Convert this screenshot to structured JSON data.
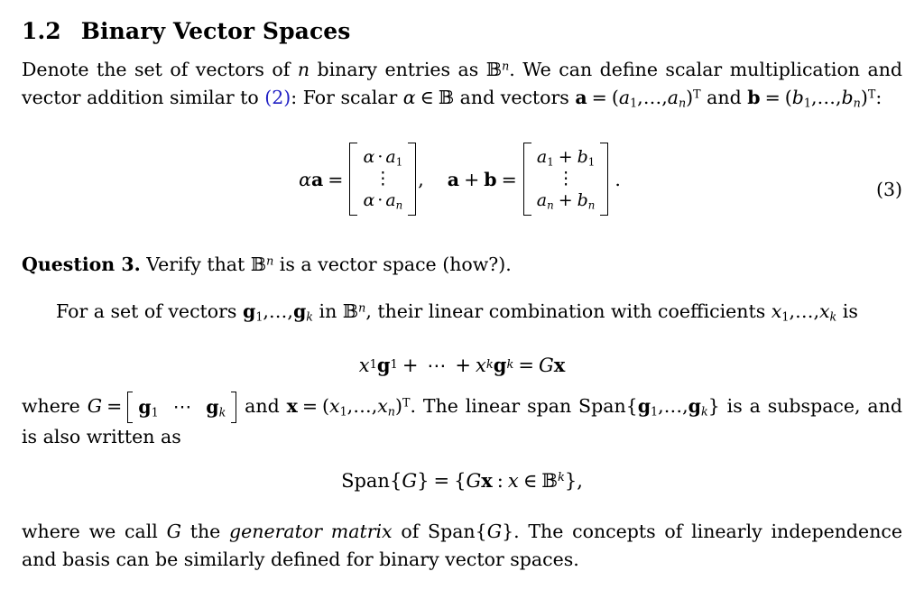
{
  "document": {
    "type": "latex-lecture-notes",
    "background_color": "#ffffff",
    "text_color": "#000000",
    "link_color": "#1f1fc4"
  },
  "section": {
    "number": "1.2",
    "title": "Binary Vector Spaces"
  },
  "paragraph_1": {
    "seg_1": "Denote the set of vectors of ",
    "var_n": "n",
    "seg_2": " binary entries as ",
    "bb_B": "B",
    "sup_n": "n",
    "seg_3": ". We can define scalar multiplication and vector addition similar to ",
    "ref_2": "(2)",
    "seg_4": ": For scalar ",
    "alpha": "α",
    "in": "∈",
    "seg_5": " and vectors ",
    "vec_a": "a",
    "equals": "=",
    "a_tuple_open": "(",
    "a_1": "a",
    "a_1_sub": "1",
    "a_dots": ",…,",
    "a_n": "a",
    "a_n_sub": "n",
    "a_tuple_close": ")",
    "transpose": "T",
    "seg_6": " and ",
    "vec_b": "b",
    "b_1": "b",
    "b_1_sub": "1",
    "b_n": "b",
    "b_n_sub": "n",
    "colon": ":"
  },
  "equation_3": {
    "number": "(3)",
    "lhs": {
      "alpha": "α",
      "vec_a": "a",
      "equals": "="
    },
    "matrix_1": {
      "rows": [
        "α · a₁",
        "⋮",
        "α · aₙ"
      ],
      "row_1_parts": {
        "alpha": "α",
        "dot": "·",
        "var": "a",
        "sub": "1"
      },
      "row_mid": "⋮",
      "row_n_parts": {
        "alpha": "α",
        "dot": "·",
        "var": "a",
        "sub": "n"
      }
    },
    "separator": ",",
    "rhs": {
      "vec_a": "a",
      "plus": "+",
      "vec_b": "b",
      "equals": "="
    },
    "matrix_2": {
      "rows": [
        "a₁ + b₁",
        "⋮",
        "aₙ + bₙ"
      ],
      "row_1_parts": {
        "a": "a",
        "a_sub": "1",
        "plus": "+",
        "b": "b",
        "b_sub": "1"
      },
      "row_mid": "⋮",
      "row_n_parts": {
        "a": "a",
        "a_sub": "n",
        "plus": "+",
        "b": "b",
        "b_sub": "n"
      }
    },
    "period": "."
  },
  "question_3": {
    "label": "Question 3.",
    "seg_1": " Verify that ",
    "bb_B": "B",
    "sup_n": "n",
    "seg_2": " is a vector space (how?)."
  },
  "paragraph_2": {
    "seg_1": "For a set of vectors ",
    "g": "g",
    "g_1_sub": "1",
    "g_dots": ",…,",
    "g_k_sub": "k",
    "seg_2": " in ",
    "bb_B": "B",
    "sup_n": "n",
    "seg_3": ", their linear combination with coefficients ",
    "x": "x",
    "x_1_sub": "1",
    "x_dots": ",…,",
    "x_k_sub": "k",
    "seg_4": " is"
  },
  "equation_lincomb": {
    "x": "x",
    "x_1_sub": "1",
    "g": "g",
    "g_1_sub": "1",
    "plus": "+",
    "cdots": "⋯",
    "x_k_sub": "k",
    "g_k_sub": "k",
    "equals": "=",
    "G": "G",
    "vec_x": "x"
  },
  "paragraph_3": {
    "seg_1": "where ",
    "G": "G",
    "equals": "=",
    "g": "g",
    "g_1_sub": "1",
    "cdots": "⋯",
    "g_k_sub": "k",
    "seg_2": " and ",
    "vec_x": "x",
    "x_open": "(",
    "x": "x",
    "x_1_sub": "1",
    "x_dots": ",…,",
    "x_n_sub": "n",
    "x_close": ")",
    "transpose": "T",
    "seg_3": ". The linear span Span{",
    "span_g": "g",
    "span_g_1_sub": "1",
    "span_dots": ",…,",
    "span_g_k_sub": "k",
    "seg_4": "} is a subspace, and is also written as"
  },
  "equation_span": {
    "span_label": "Span",
    "brace_open": "{",
    "G": "G",
    "brace_close": "}",
    "equals": "=",
    "set_open": "{",
    "G2": "G",
    "vec_x": "x",
    "colon": ":",
    "x_italic": "x",
    "in": "∈",
    "bb_B": "B",
    "sup_k": "k",
    "set_close": "}",
    "comma": ","
  },
  "paragraph_4": {
    "seg_1": "where we call ",
    "G": "G",
    "seg_2": " the ",
    "emph": "generator matrix",
    "seg_3": " of Span{",
    "G2": "G",
    "seg_4": "}. The concepts of linearly independence and basis can be similarly defined for binary vector spaces."
  }
}
